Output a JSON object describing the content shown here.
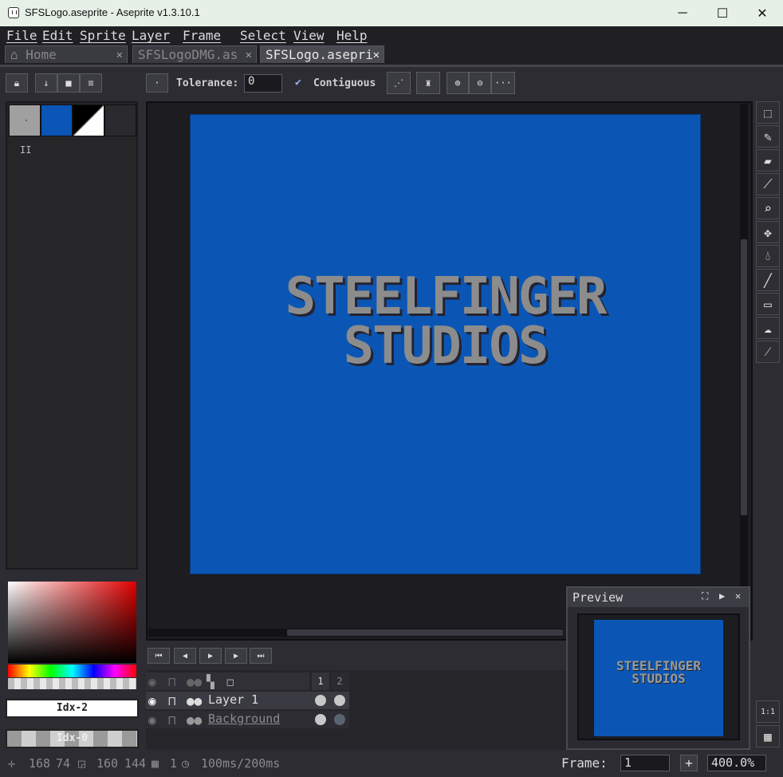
{
  "window": {
    "title": "SFSLogo.aseprite - Aseprite v1.3.10.1",
    "minimize": "─",
    "maximize": "☐",
    "close": "✕"
  },
  "menu": [
    "File",
    "Edit",
    "Sprite",
    "Layer",
    "Frame",
    "Select",
    "View",
    "Help"
  ],
  "tabs": [
    {
      "label": "Home",
      "icon": "home-icon"
    },
    {
      "label": "SFSLogoDMG.as"
    },
    {
      "label": "SFSLogo.asepri",
      "active": true
    }
  ],
  "tab_close": "✕",
  "toolbar": {
    "tolerance_label": "Tolerance:",
    "tolerance_value": "0",
    "contiguous_label": "Contiguous",
    "more": "···"
  },
  "palette": {
    "swatches": [
      "#a0a0a0",
      "#0a55b5",
      "#ffffff",
      "#2a2a2e"
    ],
    "marker": "II"
  },
  "color_fields": {
    "fg": "Idx-2",
    "bg": "Idx-0"
  },
  "canvas": {
    "background": "#0b56b4",
    "text_line1": "STEELFINGER",
    "text_line2": "STUDIOS"
  },
  "preview": {
    "title": "Preview",
    "line1": "STEELFINGER",
    "line2": "STUDIOS"
  },
  "timeline": {
    "frames": [
      "1",
      "2"
    ],
    "layers": [
      {
        "name": "Layer 1",
        "underline": false
      },
      {
        "name": "Background",
        "underline": true
      }
    ]
  },
  "right_tools": [
    "marquee-icon",
    "pencil-icon",
    "eraser-icon",
    "eyedropper-icon",
    "zoom-icon",
    "move-icon",
    "fill-icon",
    "line-icon",
    "rectangle-icon",
    "blur-icon",
    "filters-icon"
  ],
  "status": {
    "cursor_x": "168",
    "cursor_y": "74",
    "size_w": "160",
    "size_h": "144",
    "frame": "1",
    "duration": "100ms/200ms",
    "frame_label": "Frame:",
    "frame_value": "1",
    "zoom": "400.0%"
  },
  "zoom_reset": "1:1"
}
